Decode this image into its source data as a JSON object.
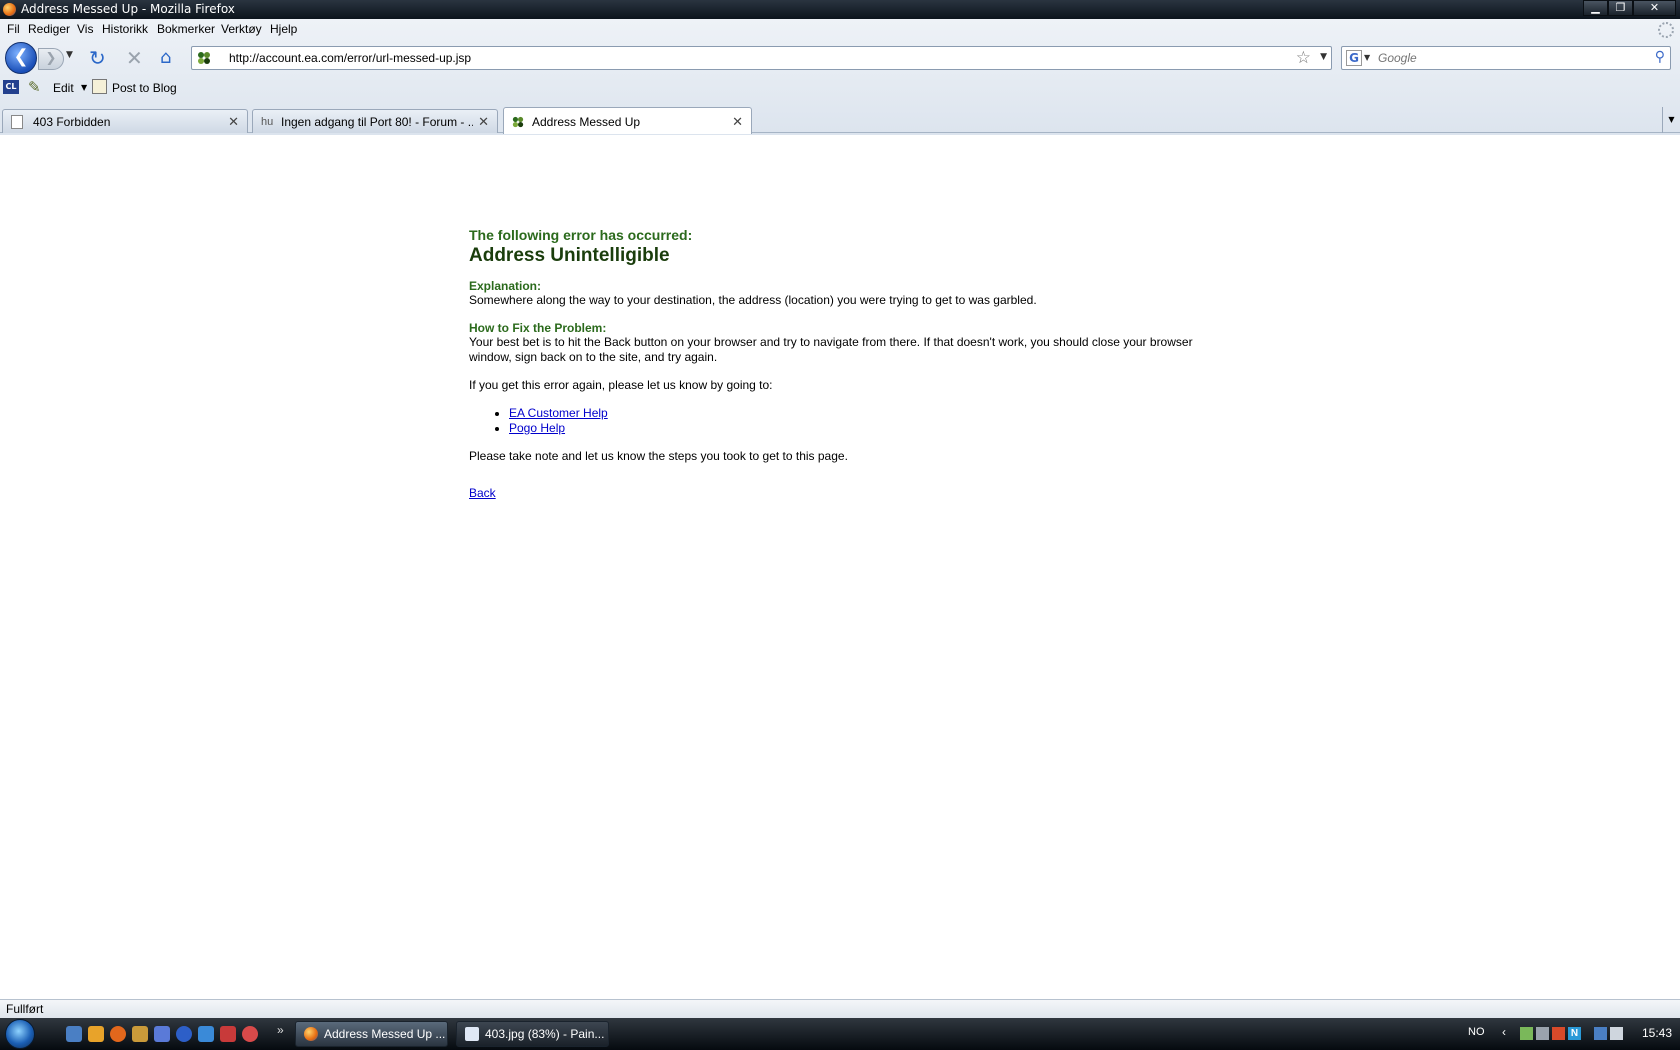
{
  "window": {
    "title": "Address Messed Up - Mozilla Firefox"
  },
  "menu": [
    "Fil",
    "Rediger",
    "Vis",
    "Historikk",
    "Bokmerker",
    "Verktøy",
    "Hjelp"
  ],
  "navigation": {
    "url": "http://account.ea.com/error/url-messed-up.jsp",
    "search_placeholder": "Google"
  },
  "bookmarks": {
    "edit_label": "Edit",
    "post_to_blog_label": "Post to Blog"
  },
  "tabs": [
    {
      "title": "403 Forbidden",
      "active": false
    },
    {
      "title": "Ingen adgang til Port 80! - Forum - ...",
      "active": false
    },
    {
      "title": "Address Messed Up",
      "active": true
    }
  ],
  "page": {
    "error_intro": "The following error has occurred:",
    "error_title": "Address Unintelligible",
    "explanation_label": "Explanation:",
    "explanation_text": "Somewhere along the way to your destination, the address (location) you were trying to get to was garbled.",
    "fix_label": "How to Fix the Problem:",
    "fix_text": "Your best bet is to hit the Back button on your browser and try to navigate from there. If that doesn't work, you should close your browser window, sign back on to the site, and try again.",
    "contact_text": "If you get this error again, please let us know by going to:",
    "help_links": [
      "EA Customer Help",
      "Pogo Help"
    ],
    "note_text": "Please take note and let us know the steps you took to get to this page.",
    "back_link": "Back"
  },
  "status": {
    "text": "Fullført"
  },
  "taskbar": {
    "tasks": [
      {
        "label": "Address Messed Up ...",
        "active": true
      },
      {
        "label": "403.jpg (83%) - Pain...",
        "active": false
      }
    ],
    "language": "NO",
    "clock": "15:43"
  }
}
